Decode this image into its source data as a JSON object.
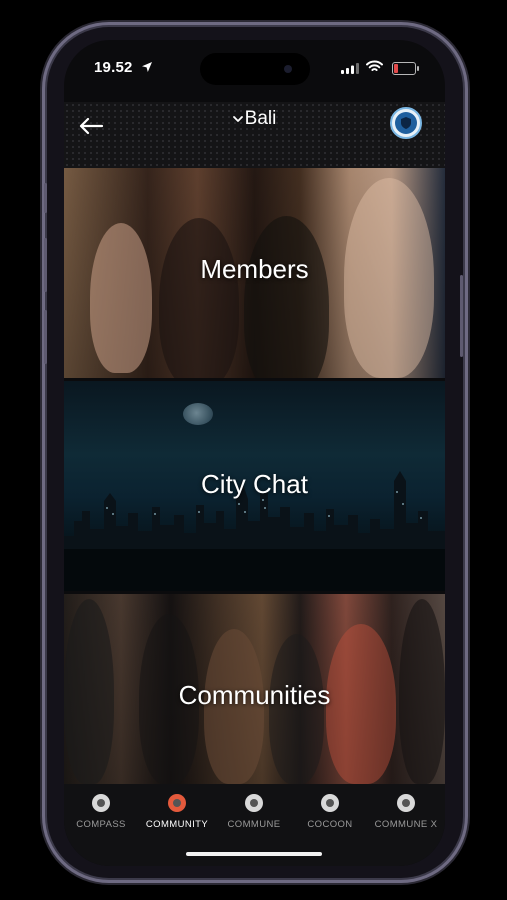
{
  "status_bar": {
    "time": "19.52",
    "icons": [
      "location-arrow-icon",
      "cellular-signal-icon",
      "wifi-icon",
      "battery-low-icon"
    ],
    "battery_level": 0.2,
    "battery_color": "#e34b4b"
  },
  "header": {
    "back_icon": "arrow-left-icon",
    "city_icon": "chevron-down-icon",
    "city": "Bali",
    "profile_icon": "shield-badge-icon"
  },
  "tiles": [
    {
      "label": "Members"
    },
    {
      "label": "City Chat"
    },
    {
      "label": "Communities"
    }
  ],
  "tabbar": {
    "active_index": 1,
    "accent": "#e45a3c",
    "items": [
      {
        "label": "COMPASS",
        "icon": "compass-icon"
      },
      {
        "label": "COMMUNITY",
        "icon": "community-icon"
      },
      {
        "label": "COMMUNE",
        "icon": "commune-icon"
      },
      {
        "label": "COCOON",
        "icon": "cocoon-icon"
      },
      {
        "label": "COMMUNE X",
        "icon": "commune-x-icon"
      }
    ]
  }
}
